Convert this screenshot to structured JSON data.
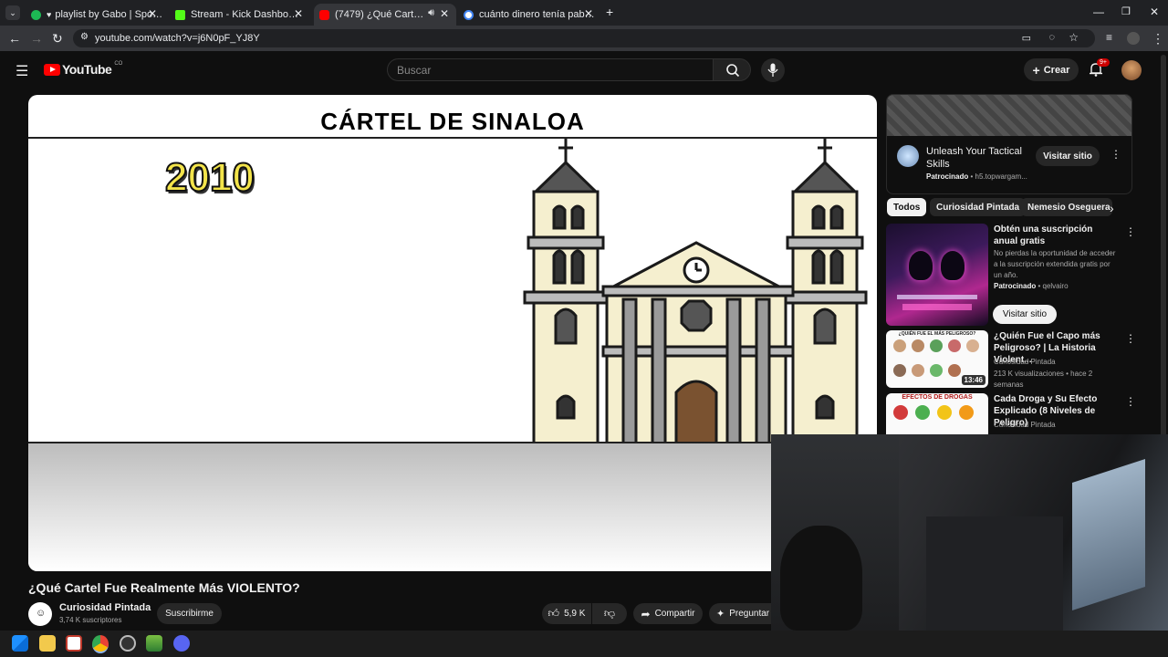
{
  "browser": {
    "tabs": [
      {
        "label": "playlist by Gabo | Spotify",
        "prefix": "•",
        "color": "#1db954",
        "active": false
      },
      {
        "label": "Stream - Kick Dashboard",
        "color": "#53fc18",
        "active": false
      },
      {
        "label": "(7479) ¿Qué Cartel Fue Real",
        "color": "#ff0000",
        "active": true
      },
      {
        "label": "cuánto dinero tenía pablo esco",
        "color": "#4285f4",
        "active": false
      }
    ],
    "url": "youtube.com/watch?v=j6N0pF_YJ8Y"
  },
  "youtube": {
    "logo_text": "YouTube",
    "country_code": "CO",
    "search_placeholder": "Buscar",
    "create_label": "Crear",
    "notifications_badge": "9+"
  },
  "video": {
    "frame_title": "CÁRTEL DE SINALOA",
    "frame_year": "2010",
    "title": "¿Qué Cartel Fue Realmente Más VIOLENTO?",
    "channel": "Curiosidad Pintada",
    "subscribers": "3,74 K suscriptores",
    "subscribe_label": "Suscribirme",
    "likes": "5,9 K",
    "share_label": "Compartir",
    "ask_label": "Preguntar"
  },
  "sidebar": {
    "ad": {
      "title": "Unleash Your Tactical Skills",
      "sponsored": "Patrocinado",
      "domain": "h5.topwargam...",
      "cta": "Visitar sitio"
    },
    "chips": [
      "Todos",
      "Curiosidad Pintada",
      "Nemesio Oseguera"
    ],
    "recommendations": [
      {
        "title": "Obtén una suscripción anual gratis",
        "description": "No pierdas la oportunidad de acceder a la suscripción extendida gratis por un año.",
        "sponsored": "Patrocinado",
        "advertiser": "qelvairo",
        "cta": "Visitar sitio"
      },
      {
        "title": "¿Quién Fue el Capo más Peligroso? | La Historia Violent...",
        "channel": "Curiosidad Pintada",
        "meta": "213 K visualizaciones • hace 2 semanas",
        "duration": "13:46",
        "thumb_text": "¿QUIÉN FUE EL MÁS PELIGROSO?"
      },
      {
        "title": "Cada Droga y Su Efecto Explicado (8 Niveles de Peligro)",
        "channel": "Curiosidad Pintada",
        "thumb_text": "EFECTOS DE DROGAS"
      }
    ]
  }
}
